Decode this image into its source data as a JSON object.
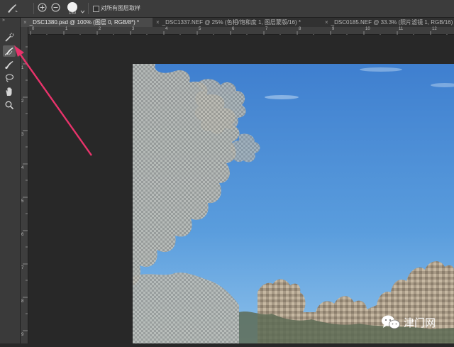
{
  "options_bar": {
    "brush_size": "150",
    "sample_all_layers_label": "对所有图层取样",
    "sample_all_layers_checked": false
  },
  "tabs": [
    {
      "label": "_DSC1380.psd @ 100% (图层 0, RGB/8*) *",
      "active": true
    },
    {
      "label": "_DSC1337.NEF @ 25% (色相/饱和度 1, 图层蒙版/16) *",
      "active": false
    },
    {
      "label": "_DSC0185.NEF @ 33.3% (照片滤镜 1, RGB/16) *",
      "active": false
    }
  ],
  "tools": [
    {
      "name": "quick-selection-tool",
      "selected": false
    },
    {
      "name": "refine-edge-brush-tool",
      "selected": true
    },
    {
      "name": "brush-tool",
      "selected": false
    },
    {
      "name": "lasso-tool",
      "selected": false
    },
    {
      "name": "hand-tool",
      "selected": false
    },
    {
      "name": "zoom-tool",
      "selected": false
    }
  ],
  "rulers": {
    "top_labels": [
      "0",
      "1",
      "2",
      "3",
      "4",
      "5",
      "6",
      "7",
      "8",
      "9",
      "10",
      "11",
      "12"
    ],
    "left_labels": [
      "1",
      "2",
      "3",
      "4",
      "5",
      "6",
      "7",
      "8",
      "9"
    ]
  },
  "colors": {
    "annotation_arrow": "#e8336b",
    "sky_top": "#3f7fcf",
    "sky_bottom": "#8cc0ea"
  },
  "watermark": {
    "text": "津门网",
    "icon": "wechat-icon"
  }
}
